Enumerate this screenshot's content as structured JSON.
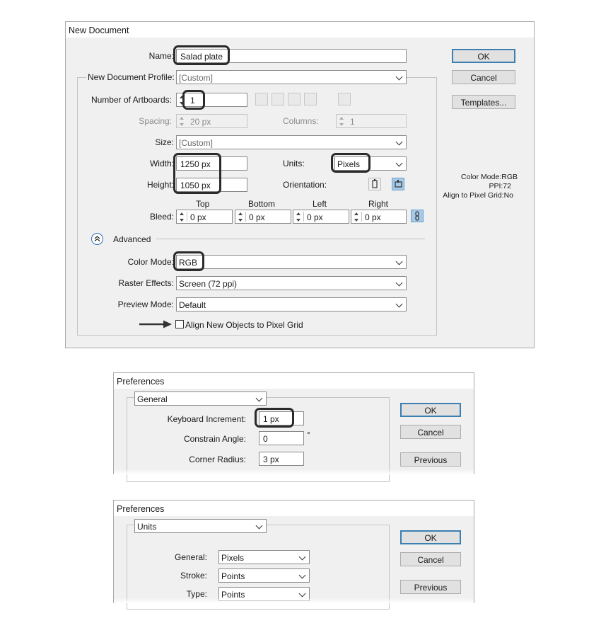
{
  "new_document": {
    "title": "New Document",
    "name_label": "Name:",
    "name_value": "Salad plate",
    "profile_label": "New Document Profile:",
    "profile_value": "[Custom]",
    "artboards_label": "Number of Artboards:",
    "artboards_value": "1",
    "spacing_label": "Spacing:",
    "spacing_value": "20 px",
    "columns_label": "Columns:",
    "columns_value": "1",
    "size_label": "Size:",
    "size_value": "[Custom]",
    "width_label": "Width:",
    "width_value": "1250 px",
    "units_label": "Units:",
    "units_value": "Pixels",
    "height_label": "Height:",
    "height_value": "1050 px",
    "orientation_label": "Orientation:",
    "bleed_label": "Bleed:",
    "bleed_headers": {
      "top": "Top",
      "bottom": "Bottom",
      "left": "Left",
      "right": "Right"
    },
    "bleed_values": {
      "top": "0 px",
      "bottom": "0 px",
      "left": "0 px",
      "right": "0 px"
    },
    "advanced_label": "Advanced",
    "color_mode_label": "Color Mode:",
    "color_mode_value": "RGB",
    "raster_label": "Raster Effects:",
    "raster_value": "Screen (72 ppi)",
    "preview_label": "Preview Mode:",
    "preview_value": "Default",
    "align_label": "Align New Objects to Pixel Grid",
    "align_checked": false,
    "ok_label": "OK",
    "cancel_label": "Cancel",
    "templates_label": "Templates...",
    "info_color_mode": "Color Mode:RGB",
    "info_ppi": "PPI:72",
    "info_align": "Align to Pixel Grid:No"
  },
  "prefs_general": {
    "title": "Preferences",
    "section_value": "General",
    "keyboard_label": "Keyboard Increment:",
    "keyboard_value": "1 px",
    "angle_label": "Constrain Angle:",
    "angle_value": "0",
    "degree_symbol": "°",
    "radius_label": "Corner Radius:",
    "radius_value": "3 px",
    "ok_label": "OK",
    "cancel_label": "Cancel",
    "previous_label": "Previous"
  },
  "prefs_units": {
    "title": "Preferences",
    "section_value": "Units",
    "general_label": "General:",
    "general_value": "Pixels",
    "stroke_label": "Stroke:",
    "stroke_value": "Points",
    "type_label": "Type:",
    "type_value": "Points",
    "ok_label": "OK",
    "cancel_label": "Cancel",
    "previous_label": "Previous"
  },
  "colors": {
    "dialog_bg": "#f0f0f0",
    "default_button_border": "#3c7fb1",
    "highlight": "#2b2b2b",
    "link_button": "#a7c9e8"
  }
}
